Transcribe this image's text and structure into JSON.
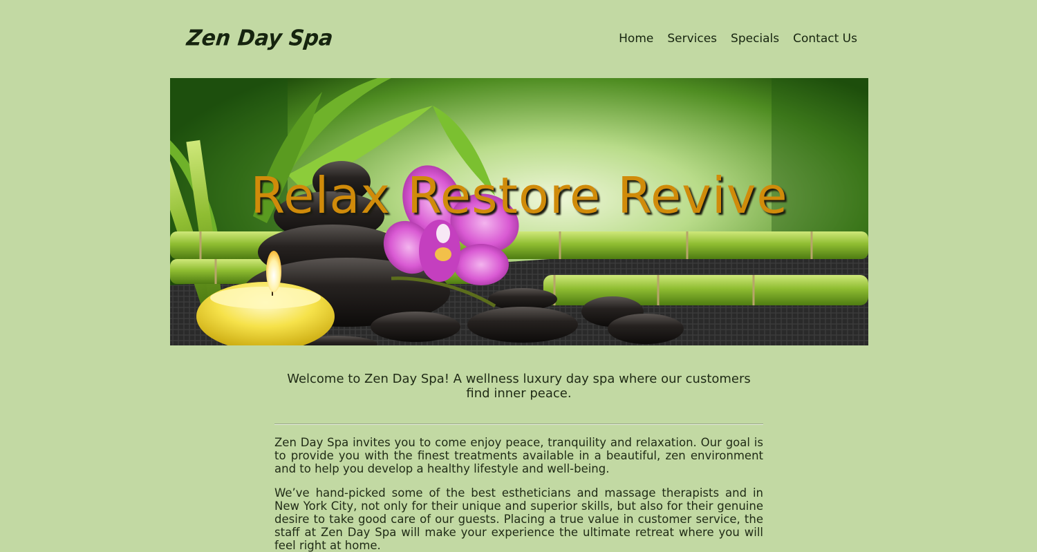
{
  "header": {
    "logo_text": "Zen Day Spa",
    "nav": [
      "Home",
      "Services",
      "Specials",
      "Contact Us"
    ]
  },
  "hero": {
    "title": "Relax Restore Revive"
  },
  "main": {
    "welcome": "Welcome to Zen Day Spa! A wellness luxury day spa where our customers find inner peace.",
    "paragraphs": [
      "Zen Day Spa invites you to come enjoy peace, tranquility and relaxation. Our goal is to provide you with the finest treatments available in a beautiful, zen environment and to help you develop a healthy lifestyle and well-being.",
      "We’ve hand-picked some of the best estheticians and massage therapists and in New York City, not only for their unique and superior skills, but also for their genuine desire to take good care of our guests. Placing a true value in customer service, the staff at Zen Day Spa will make your experience the ultimate retreat where you will feel right at home."
    ]
  },
  "colors": {
    "page_background": "#c2d9a3",
    "hero_title": "#d08b0a",
    "text": "#1f2a15"
  }
}
